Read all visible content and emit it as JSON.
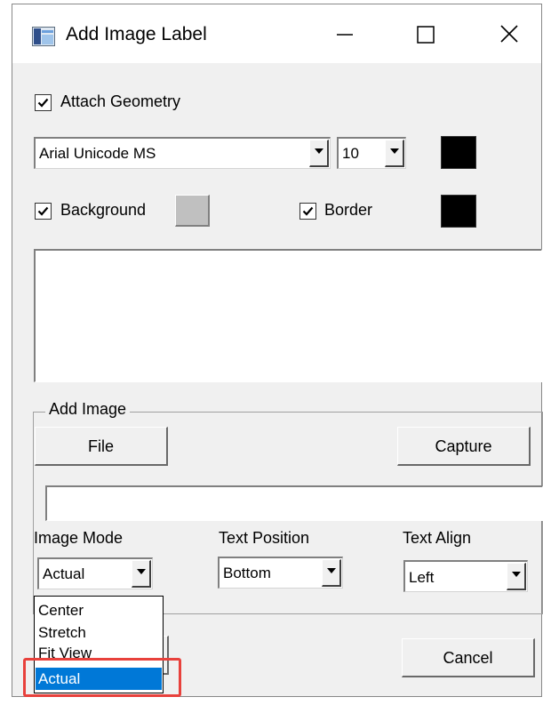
{
  "window": {
    "title": "Add Image Label",
    "controls": {
      "minimize": "—",
      "maximize": "☐",
      "close": "✕"
    }
  },
  "attach_geometry": {
    "label": "Attach Geometry",
    "checked": true
  },
  "font": {
    "family": "Arial Unicode MS",
    "size": "10",
    "color": "#000000"
  },
  "background": {
    "label": "Background",
    "checked": true,
    "color": "#c0c0c0"
  },
  "border": {
    "label": "Border",
    "checked": true,
    "color": "#000000"
  },
  "label_text": "",
  "add_image": {
    "group_title": "Add Image",
    "file_button": "File",
    "capture_button": "Capture",
    "path": ""
  },
  "image_mode": {
    "label": "Image Mode",
    "value": "Actual",
    "options": [
      "Center",
      "Stretch",
      "Fit View",
      "Actual"
    ],
    "selected_option": "Actual"
  },
  "text_position": {
    "label": "Text Position",
    "value": "Bottom"
  },
  "text_align": {
    "label": "Text Align",
    "value": "Left"
  },
  "footer": {
    "cancel_button": "Cancel"
  },
  "accent_colors": {
    "selection": "#0078d7",
    "annotation_highlight": "#e8413c"
  }
}
